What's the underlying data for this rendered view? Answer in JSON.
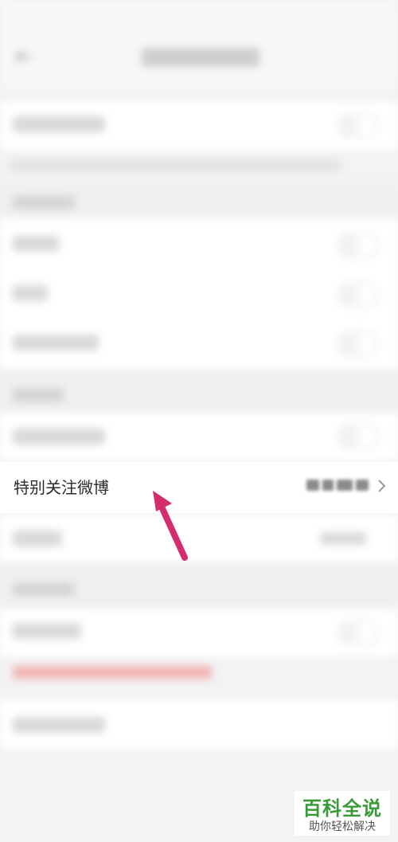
{
  "settings": {
    "special_follow_label": "特别关注微博"
  },
  "watermark": {
    "title": "百科全说",
    "subtitle": "助你轻松解决"
  },
  "colors": {
    "arrow": "#d42c6c",
    "watermark_green": "#3a9a3a",
    "warning_text": "#f2b3b3"
  },
  "icons": {
    "back": "back-arrow-icon",
    "row_chevron": "chevron-right-icon",
    "annotation": "annotation-arrow-icon"
  }
}
